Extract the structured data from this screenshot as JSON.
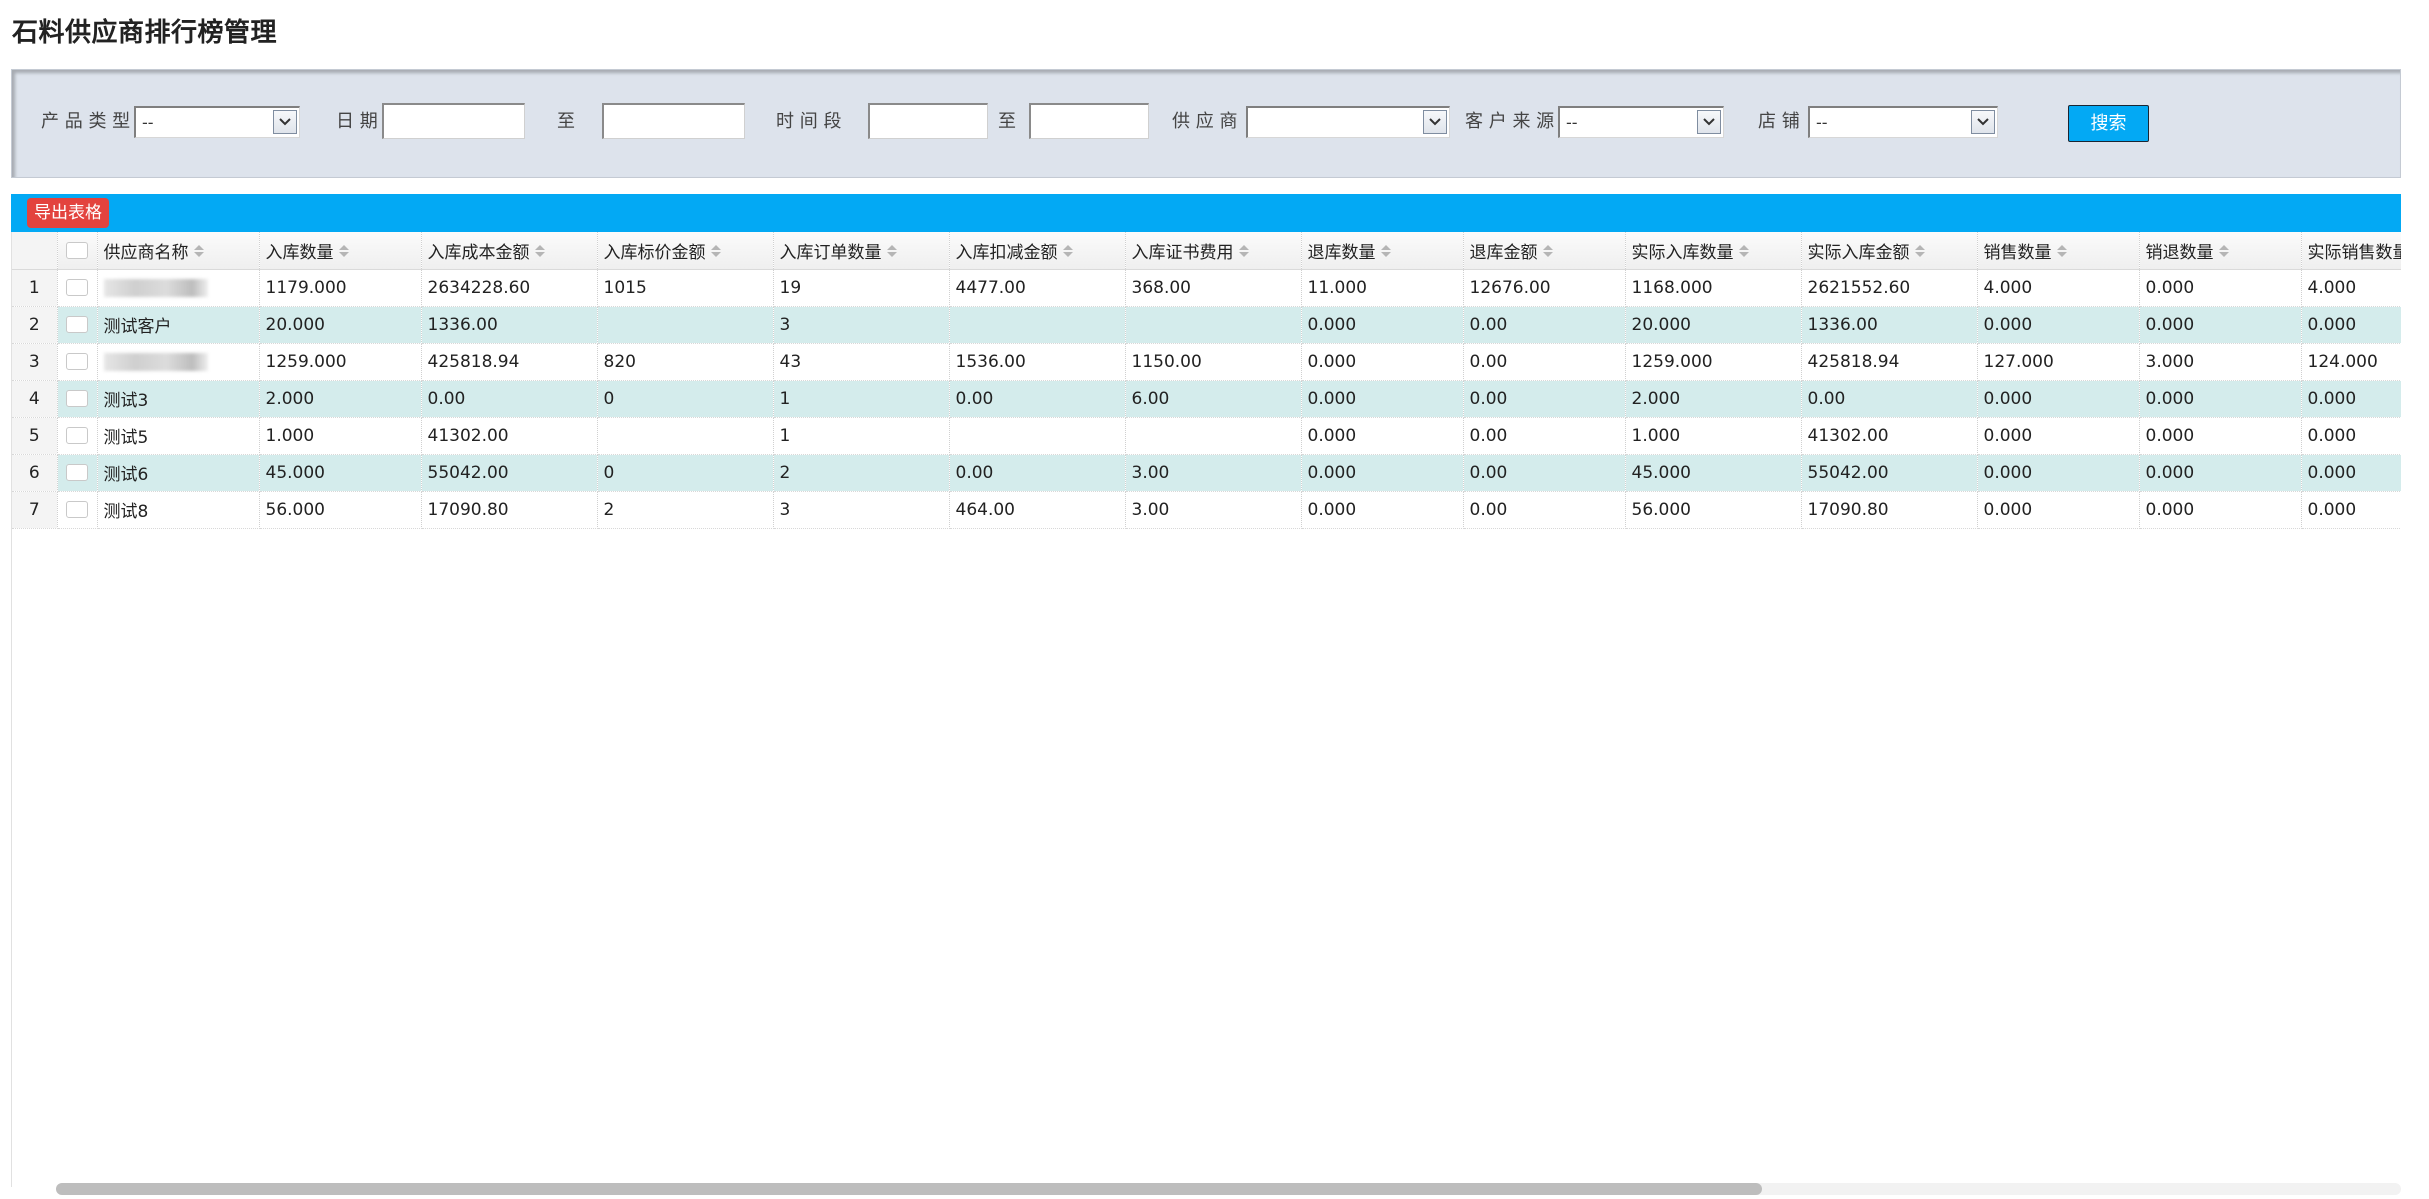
{
  "page_title": "石料供应商排行榜管理",
  "filters": {
    "product_type_label": "产 品 类 型",
    "product_type_value": "--",
    "date_label": "日 期",
    "date_from": "",
    "to_label_1": "至",
    "date_to": "",
    "time_range_label": "时 间 段",
    "time_from": "",
    "to_label_2": "至",
    "time_to": "",
    "supplier_label": "供 应 商",
    "supplier_value": "",
    "customer_source_label": "客 户 来 源",
    "customer_source_value": "--",
    "store_label": "店 铺",
    "store_value": "--",
    "search_button": "搜索"
  },
  "toolbar": {
    "export_button": "导出表格"
  },
  "table": {
    "columns": [
      "供应商名称",
      "入库数量",
      "入库成本金额",
      "入库标价金额",
      "入库订单数量",
      "入库扣减金额",
      "入库证书费用",
      "退库数量",
      "退库金额",
      "实际入库数量",
      "实际入库金额",
      "销售数量",
      "销退数量",
      "实际销售数量"
    ],
    "rows": [
      {
        "num": "1",
        "blurred": true,
        "name": "",
        "cells": [
          "1179.000",
          "2634228.60",
          "1015",
          "19",
          "4477.00",
          "368.00",
          "11.000",
          "12676.00",
          "1168.000",
          "2621552.60",
          "4.000",
          "0.000",
          "4.000"
        ]
      },
      {
        "num": "2",
        "blurred": false,
        "name": "测试客户",
        "cells": [
          "20.000",
          "1336.00",
          "",
          "3",
          "",
          "",
          "0.000",
          "0.00",
          "20.000",
          "1336.00",
          "0.000",
          "0.000",
          "0.000"
        ]
      },
      {
        "num": "3",
        "blurred": true,
        "name": "",
        "cells": [
          "1259.000",
          "425818.94",
          "820",
          "43",
          "1536.00",
          "1150.00",
          "0.000",
          "0.00",
          "1259.000",
          "425818.94",
          "127.000",
          "3.000",
          "124.000"
        ]
      },
      {
        "num": "4",
        "blurred": false,
        "name": "测试3",
        "cells": [
          "2.000",
          "0.00",
          "0",
          "1",
          "0.00",
          "6.00",
          "0.000",
          "0.00",
          "2.000",
          "0.00",
          "0.000",
          "0.000",
          "0.000"
        ]
      },
      {
        "num": "5",
        "blurred": false,
        "name": "测试5",
        "cells": [
          "1.000",
          "41302.00",
          "",
          "1",
          "",
          "",
          "0.000",
          "0.00",
          "1.000",
          "41302.00",
          "0.000",
          "0.000",
          "0.000"
        ]
      },
      {
        "num": "6",
        "blurred": false,
        "name": "测试6",
        "cells": [
          "45.000",
          "55042.00",
          "0",
          "2",
          "0.00",
          "3.00",
          "0.000",
          "0.00",
          "45.000",
          "55042.00",
          "0.000",
          "0.000",
          "0.000"
        ]
      },
      {
        "num": "7",
        "blurred": false,
        "name": "测试8",
        "cells": [
          "56.000",
          "17090.80",
          "2",
          "3",
          "464.00",
          "3.00",
          "0.000",
          "0.00",
          "56.000",
          "17090.80",
          "0.000",
          "0.000",
          "0.000"
        ]
      }
    ]
  },
  "colors": {
    "header_bar": "#03a9f4",
    "export_button": "#e3433e",
    "alt_row": "#d4ecec",
    "filter_panel": "#dde3ec"
  }
}
